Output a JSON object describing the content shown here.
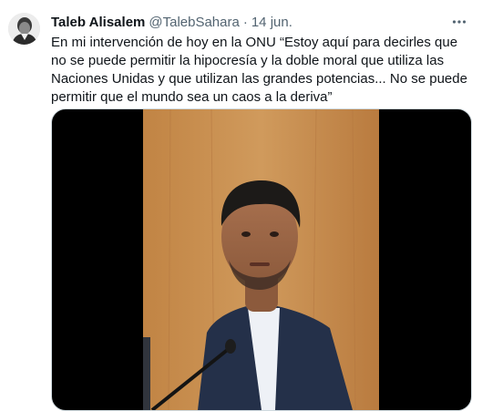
{
  "tweet": {
    "display_name": "Taleb Alisalem",
    "handle": "@TalebSahara",
    "separator": "·",
    "date": "14 jun.",
    "text": "En mi intervención de hoy en la ONU “Estoy aquí para decirles que no se puede permitir la hipocresía y la doble moral que utiliza las Naciones Unidas y que utilizan las grandes potencias... No se puede permitir que el mundo sea un caos a la deriva”",
    "more_icon": "more-horizontal-icon"
  },
  "colors": {
    "text_primary": "#0f1419",
    "text_secondary": "#536471",
    "border": "#cfd9de",
    "video_background": "#000000",
    "backdrop_wood": "#c98f4e",
    "jacket": "#243049"
  }
}
